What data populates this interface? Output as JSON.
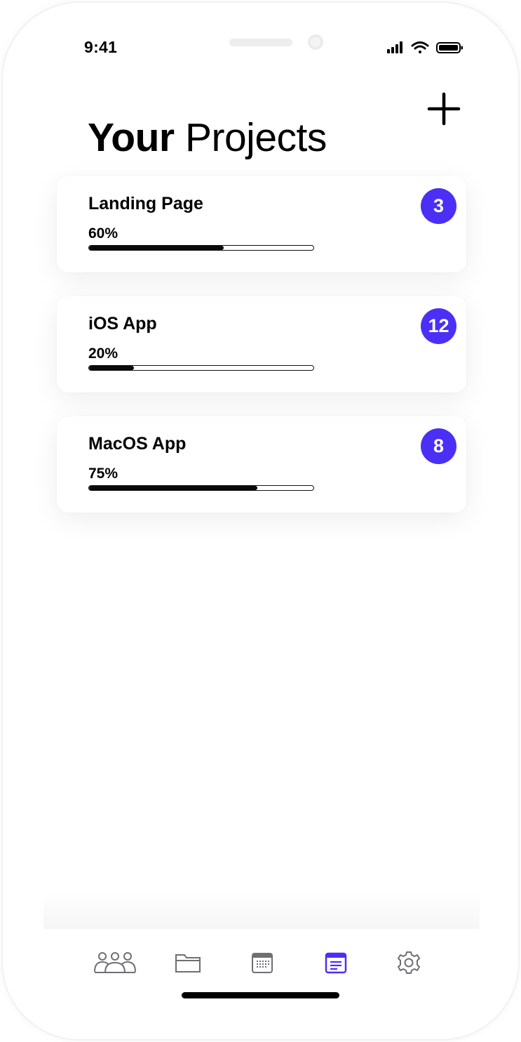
{
  "status_bar": {
    "time": "9:41",
    "icons": [
      "signal-icon",
      "wifi-icon",
      "battery-icon"
    ]
  },
  "header": {
    "title_bold": "Your",
    "title_regular": "Projects",
    "add_icon": "plus-icon"
  },
  "projects": [
    {
      "name": "Landing Page",
      "progress_label": "60%",
      "progress": 0.6,
      "count": "3"
    },
    {
      "name": "iOS App",
      "progress_label": "20%",
      "progress": 0.2,
      "count": "12"
    },
    {
      "name": "MacOS App",
      "progress_label": "75%",
      "progress": 0.75,
      "count": "8"
    }
  ],
  "tab_bar": {
    "tabs": [
      {
        "icon": "team-icon",
        "active": false
      },
      {
        "icon": "folder-icon",
        "active": false
      },
      {
        "icon": "calendar-icon",
        "active": false
      },
      {
        "icon": "list-icon",
        "active": true
      },
      {
        "icon": "gear-icon",
        "active": false
      }
    ]
  },
  "colors": {
    "accent": "#4b2ff5",
    "inactive_icon": "#6e6e73",
    "text": "#000000"
  }
}
